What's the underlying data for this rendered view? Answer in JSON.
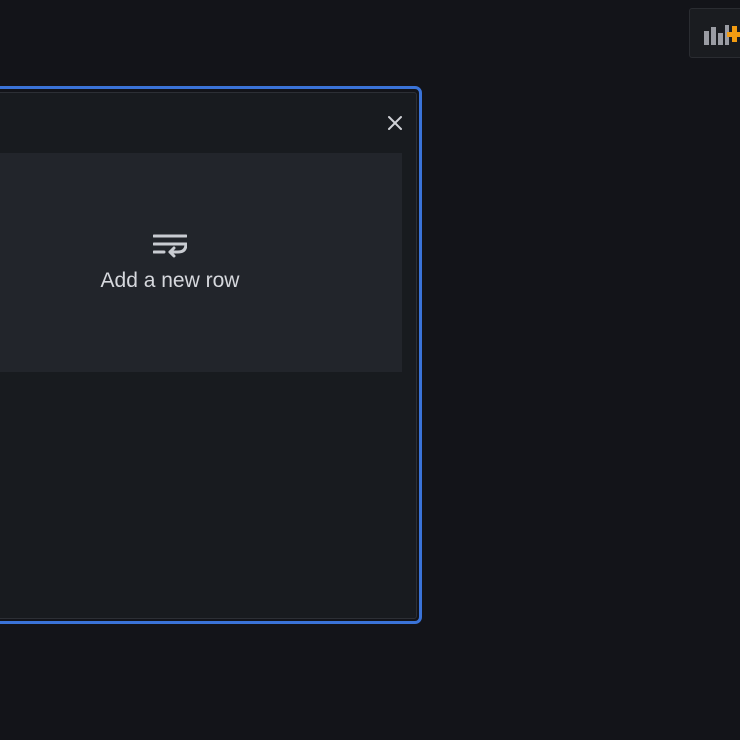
{
  "colors": {
    "background": "#131419",
    "panel": "#181b1f",
    "card": "#22252b",
    "selection_outline": "#3a73d8",
    "icon": "#c9ccd2",
    "accent_plus": "#f39c12"
  },
  "toolbar": {
    "add_panel_icon": "add-panel-icon"
  },
  "panel": {
    "close_icon": "close-icon",
    "add_row": {
      "icon": "text-wrap-icon",
      "label": "Add a new row"
    }
  }
}
